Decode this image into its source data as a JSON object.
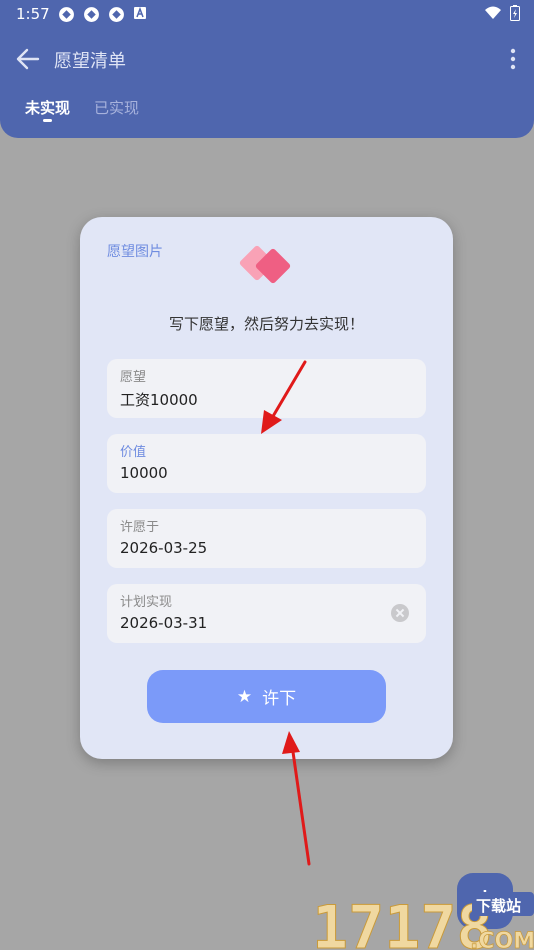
{
  "status_bar": {
    "time": "1:57"
  },
  "toolbar": {
    "title": "愿望清单"
  },
  "tabs": [
    {
      "label": "未实现",
      "active": true
    },
    {
      "label": "已实现",
      "active": false
    }
  ],
  "dialog": {
    "image_label": "愿望图片",
    "subtitle": "写下愿望，然后努力去实现！",
    "fields": [
      {
        "label": "愿望",
        "value": "工资10000"
      },
      {
        "label": "价值",
        "value": "10000"
      },
      {
        "label": "许愿于",
        "value": "2026-03-25"
      },
      {
        "label": "计划实现",
        "value": "2026-03-31"
      }
    ],
    "submit_label": "许下"
  },
  "watermark": {
    "number": "17178",
    "suffix": ".COM",
    "site": "下载站"
  },
  "colors": {
    "appbar": "#4f66ae",
    "accent": "#7b9af9",
    "arrow": "#e01a1a",
    "dialog_bg": "#e1e6f6"
  }
}
